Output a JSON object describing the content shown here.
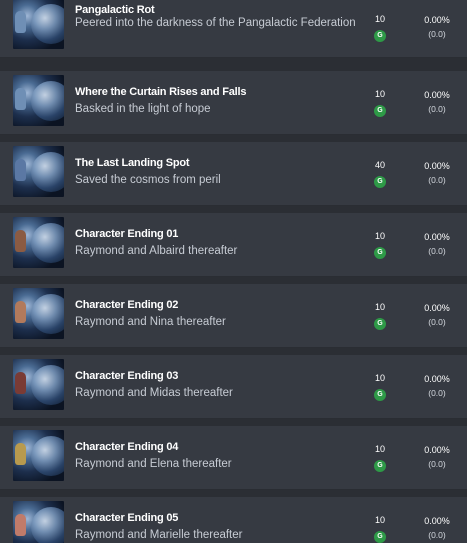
{
  "colors": {
    "background": "#2b2e34",
    "row": "#363a42",
    "gamerscore_badge": "#2e9a47"
  },
  "achievements": [
    {
      "title": "Pangalactic Rot",
      "description": "Peered into the darkness of the Pangalactic Federation",
      "points": "10",
      "badge": "G",
      "percent": "0.00%",
      "ratio": "(0.0)",
      "icon": "planet-achievement-icon"
    },
    {
      "title": "Where the Curtain Rises and Falls",
      "description": "Basked in the light of hope",
      "points": "10",
      "badge": "G",
      "percent": "0.00%",
      "ratio": "(0.0)",
      "icon": "planet-achievement-icon"
    },
    {
      "title": "The Last Landing Spot",
      "description": "Saved the cosmos from peril",
      "points": "40",
      "badge": "G",
      "percent": "0.00%",
      "ratio": "(0.0)",
      "icon": "planet-achievement-icon"
    },
    {
      "title": "Character Ending 01",
      "description": "Raymond and Albaird thereafter",
      "points": "10",
      "badge": "G",
      "percent": "0.00%",
      "ratio": "(0.0)",
      "icon": "character-portrait-icon"
    },
    {
      "title": "Character Ending 02",
      "description": "Raymond and Nina thereafter",
      "points": "10",
      "badge": "G",
      "percent": "0.00%",
      "ratio": "(0.0)",
      "icon": "character-portrait-icon"
    },
    {
      "title": "Character Ending 03",
      "description": "Raymond and Midas thereafter",
      "points": "10",
      "badge": "G",
      "percent": "0.00%",
      "ratio": "(0.0)",
      "icon": "character-portrait-icon"
    },
    {
      "title": "Character Ending 04",
      "description": "Raymond and Elena thereafter",
      "points": "10",
      "badge": "G",
      "percent": "0.00%",
      "ratio": "(0.0)",
      "icon": "character-portrait-icon"
    },
    {
      "title": "Character Ending 05",
      "description": "Raymond and Marielle thereafter",
      "points": "10",
      "badge": "G",
      "percent": "0.00%",
      "ratio": "(0.0)",
      "icon": "character-portrait-icon"
    }
  ]
}
